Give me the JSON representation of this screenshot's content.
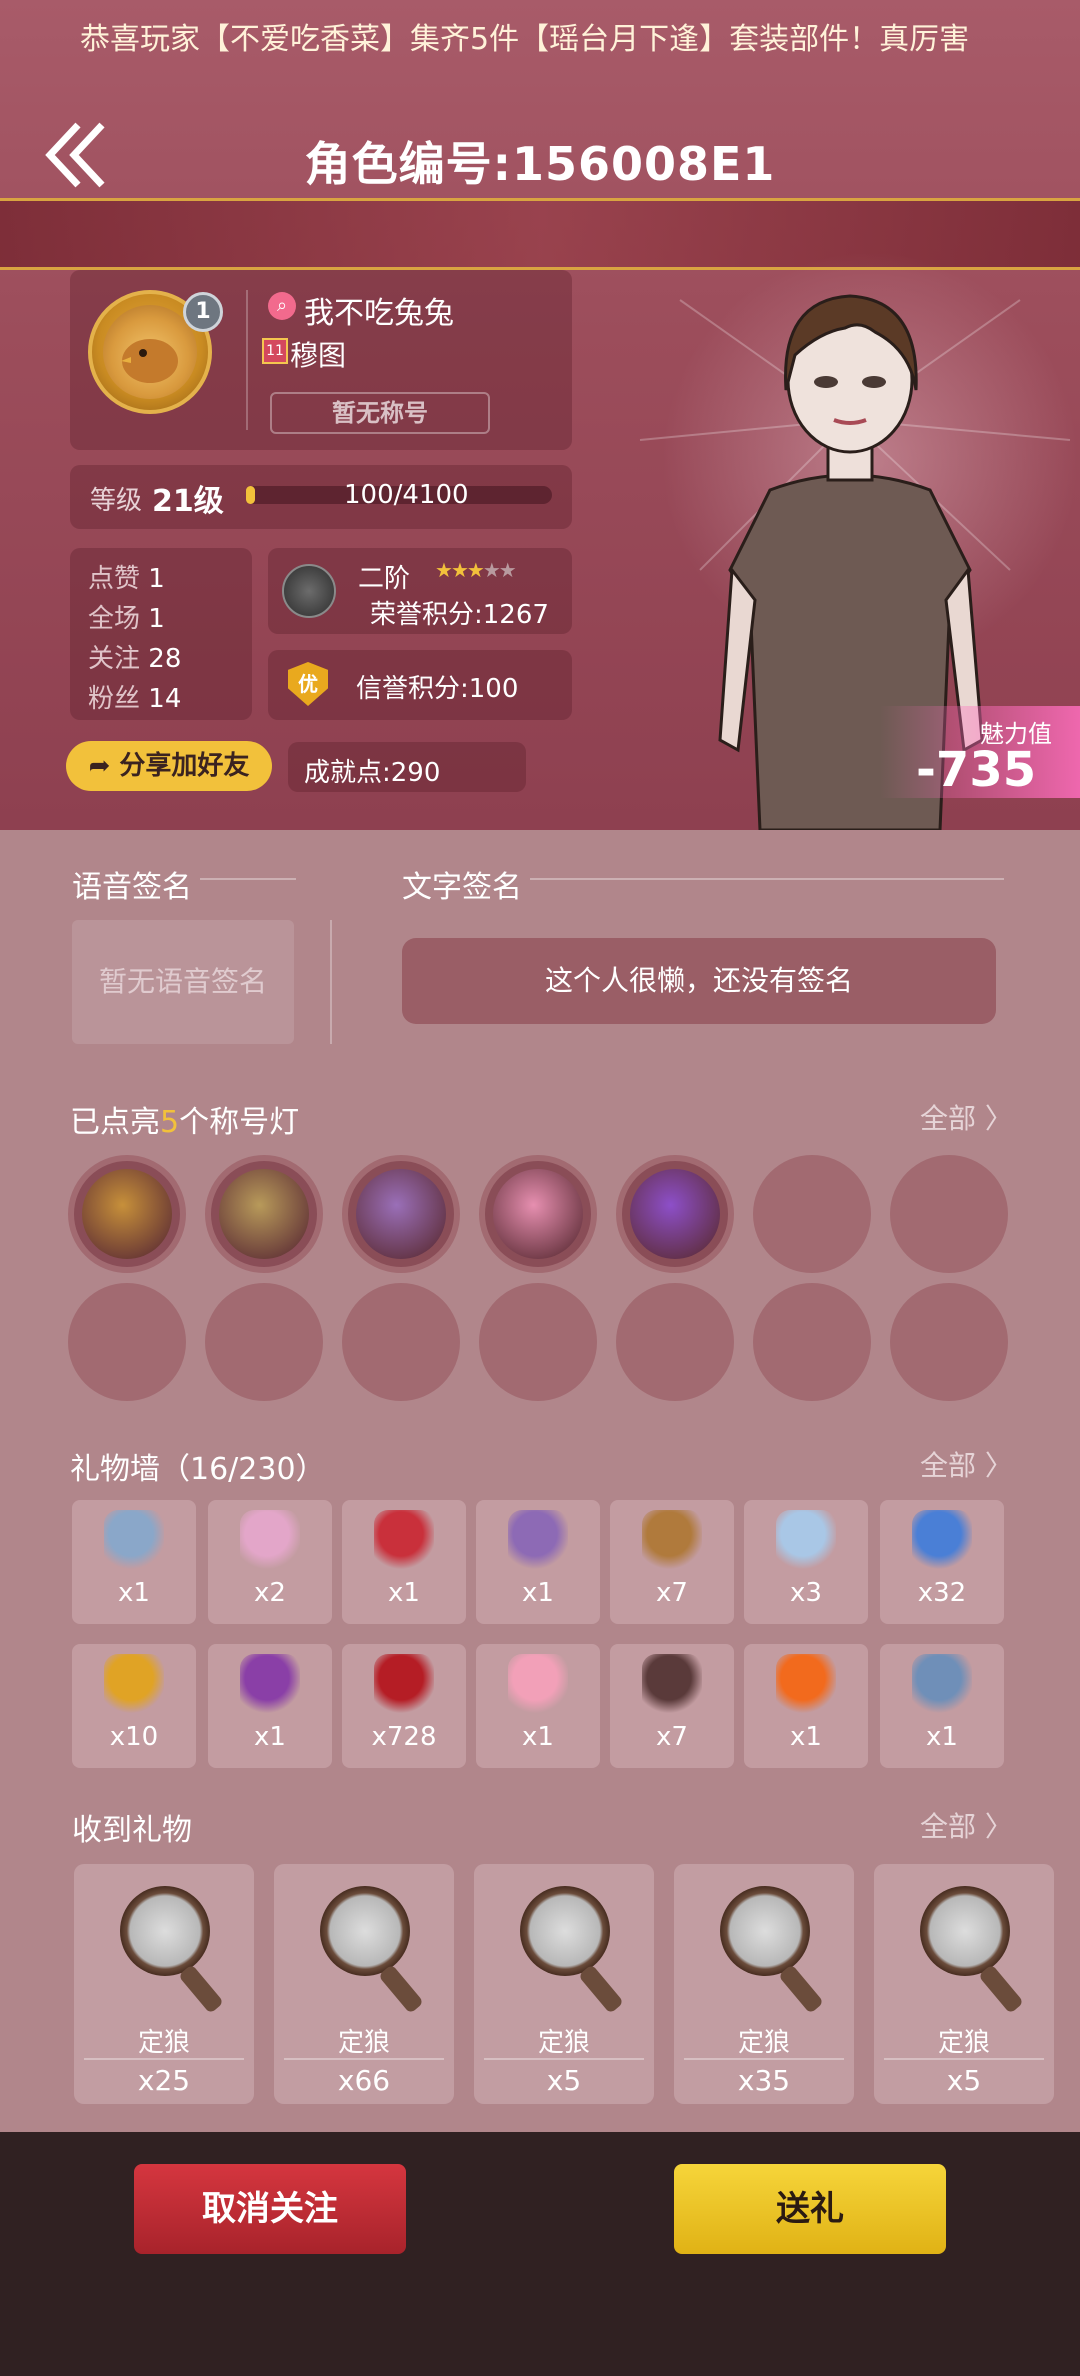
{
  "header": {
    "title": "角色编号:156008E1",
    "marquee": "恭喜玩家【不爱吃香菜】集齐5件【瑶台月下逢】套装部件！真厉害"
  },
  "profile": {
    "avatar_level": "1",
    "name": "我不吃兔兔",
    "role_icon": "11",
    "role": "穆图",
    "title_plate": "暂无称号",
    "level_label": "等级",
    "level": "21级",
    "exp_text": "100/4100",
    "exp_progress": 0.024,
    "stats": [
      {
        "label": "点赞",
        "value": "1"
      },
      {
        "label": "全场",
        "value": "1"
      },
      {
        "label": "关注",
        "value": "28"
      },
      {
        "label": "粉丝",
        "value": "14"
      }
    ],
    "rank_name": "二阶",
    "rank_stars": "★★★★★",
    "rank_stars_filled": 3,
    "honor_score": "荣誉积分:1267",
    "credit_icon": "优",
    "credit_score": "信誉积分:100",
    "share_label": "分享加好友",
    "achievement": "成就点:290",
    "charm_label": "魅力值",
    "charm_value": "-735"
  },
  "signature": {
    "voice_title": "语音签名",
    "voice_empty": "暂无语音签名",
    "text_title": "文字签名",
    "text_value": "这个人很懒，还没有签名"
  },
  "titles": {
    "prefix": "已点亮",
    "count": "5",
    "suffix": "个称号灯",
    "see_all": "全部 〉",
    "lit_colors": [
      "#c7903a",
      "#b89a5a",
      "#9a6fb8",
      "#e68fb0",
      "#8d4fc9"
    ]
  },
  "gift_wall": {
    "title": "礼物墙（16/230）",
    "see_all": "全部 〉",
    "row1": [
      {
        "count": "x1",
        "color": "#8aa7c9",
        "icon": "fish-icon"
      },
      {
        "count": "x2",
        "color": "#e3a6c9",
        "icon": "cassette-icon"
      },
      {
        "count": "x1",
        "color": "#c9303b",
        "icon": "lips-icon"
      },
      {
        "count": "x1",
        "color": "#8d6ab5",
        "icon": "earring-icon"
      },
      {
        "count": "x7",
        "color": "#b07a3c",
        "icon": "star-icon"
      },
      {
        "count": "x3",
        "color": "#a9c7e6",
        "icon": "teapot-icon"
      },
      {
        "count": "x32",
        "color": "#4a7fd6",
        "icon": "book-icon"
      }
    ],
    "row2": [
      {
        "count": "x10",
        "color": "#e0a325",
        "icon": "bird-icon"
      },
      {
        "count": "x1",
        "color": "#8a3fa7",
        "icon": "goblet-icon"
      },
      {
        "count": "x728",
        "color": "#b51d25",
        "icon": "rose-icon"
      },
      {
        "count": "x1",
        "color": "#f2a0b8",
        "icon": "cotton-candy-icon"
      },
      {
        "count": "x7",
        "color": "#5a3a3a",
        "icon": "wolf-fan-icon"
      },
      {
        "count": "x1",
        "color": "#f26a1d",
        "icon": "flame-icon"
      },
      {
        "count": "x1",
        "color": "#6f8fb8",
        "icon": "heart-icon"
      }
    ]
  },
  "received": {
    "title": "收到礼物",
    "see_all": "全部 〉",
    "items": [
      {
        "name": "定狼",
        "count": "x25"
      },
      {
        "name": "定狼",
        "count": "x66"
      },
      {
        "name": "定狼",
        "count": "x5"
      },
      {
        "name": "定狼",
        "count": "x35"
      },
      {
        "name": "定狼",
        "count": "x5"
      }
    ]
  },
  "footer": {
    "unfollow": "取消关注",
    "gift": "送礼"
  }
}
